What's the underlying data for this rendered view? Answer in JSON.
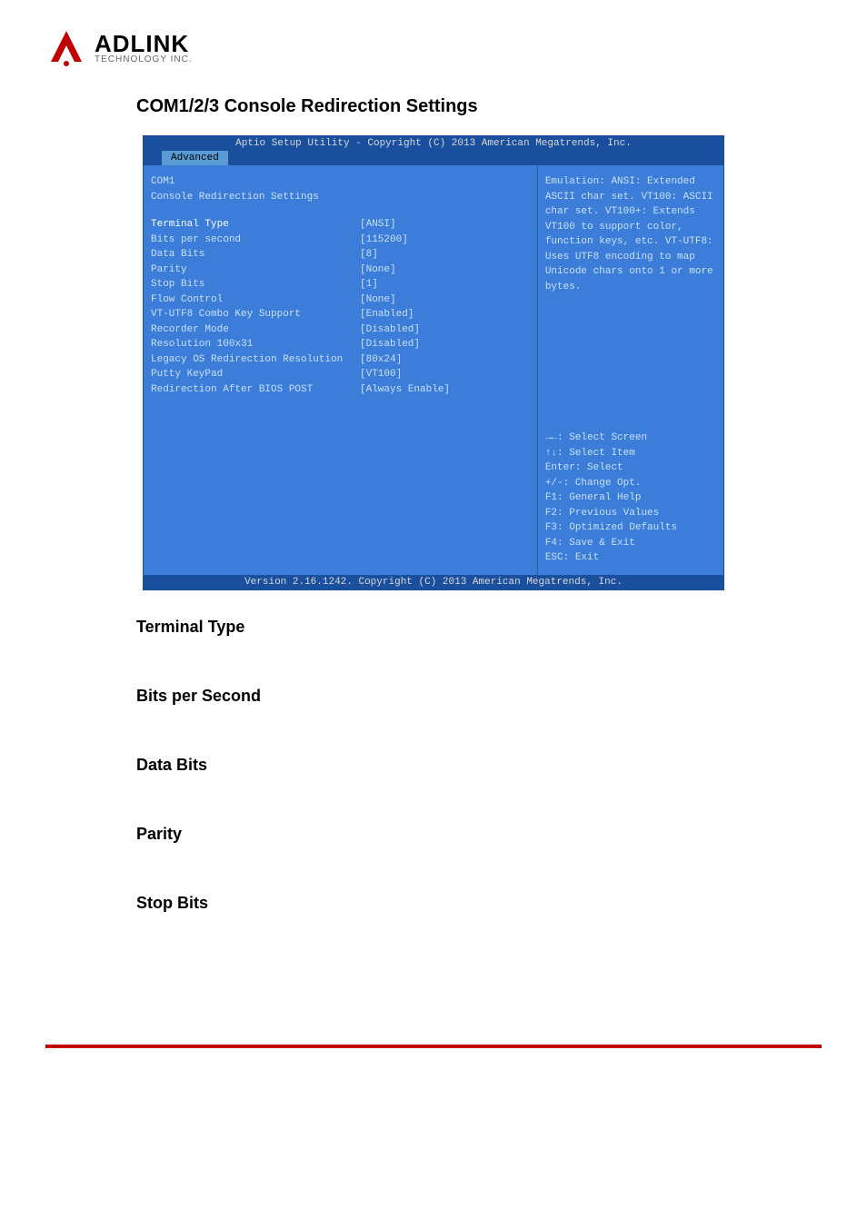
{
  "logo": {
    "main": "ADLINK",
    "sub": "TECHNOLOGY INC."
  },
  "heading": "COM1/2/3 Console Redirection Settings",
  "bios": {
    "title": "Aptio Setup Utility - Copyright (C) 2013 American Megatrends, Inc.",
    "tab": "Advanced",
    "header_lines": [
      "COM1",
      "Console Redirection Settings"
    ],
    "rows": [
      {
        "label": "Terminal Type",
        "value": "[ANSI]",
        "selected": true
      },
      {
        "label": "Bits per second",
        "value": "[115200]"
      },
      {
        "label": "Data Bits",
        "value": "[8]"
      },
      {
        "label": "Parity",
        "value": "[None]"
      },
      {
        "label": "Stop Bits",
        "value": "[1]"
      },
      {
        "label": "Flow Control",
        "value": "[None]"
      },
      {
        "label": "VT-UTF8 Combo Key Support",
        "value": "[Enabled]"
      },
      {
        "label": "Recorder Mode",
        "value": "[Disabled]"
      },
      {
        "label": "Resolution 100x31",
        "value": "[Disabled]"
      },
      {
        "label": "Legacy OS Redirection Resolution",
        "value": "[80x24]"
      },
      {
        "label": "Putty KeyPad",
        "value": "[VT100]"
      },
      {
        "label": "Redirection After BIOS POST",
        "value": "[Always Enable]"
      }
    ],
    "help_text": [
      "Emulation: ANSI: Extended",
      "ASCII char set. VT100: ASCII",
      "char set. VT100+: Extends",
      "VT100 to support color,",
      "function keys, etc. VT-UTF8:",
      "Uses UTF8 encoding to map",
      "Unicode chars onto 1 or more",
      "bytes."
    ],
    "nav_hints": [
      "→←: Select Screen",
      "↑↓: Select Item",
      "Enter: Select",
      "+/-: Change Opt.",
      "F1: General Help",
      "F2: Previous Values",
      "F3: Optimized Defaults",
      "F4: Save & Exit",
      "ESC: Exit"
    ],
    "footer": "Version 2.16.1242. Copyright (C) 2013 American Megatrends, Inc."
  },
  "sections": [
    "Terminal Type",
    "Bits per Second",
    "Data Bits",
    "Parity",
    "Stop Bits"
  ]
}
